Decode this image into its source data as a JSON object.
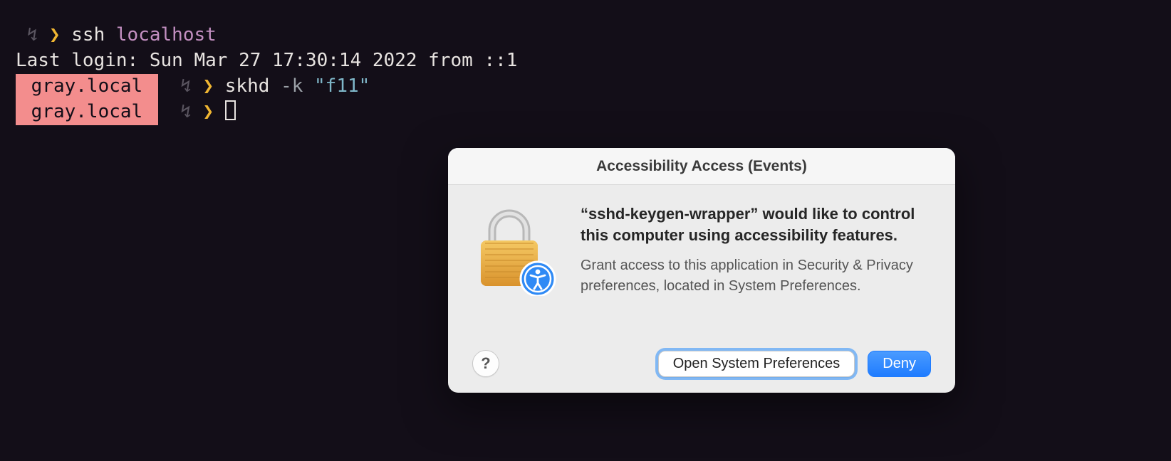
{
  "terminal": {
    "line1": {
      "arrow": "↯",
      "caret": "❯",
      "cmd": "ssh",
      "arg": "localhost"
    },
    "line2": "Last login: Sun Mar 27 17:30:14 2022 from ::1",
    "line3": {
      "host": " gray.local ",
      "arrow": "↯",
      "caret": "❯",
      "cmd": "skhd",
      "flag": "-k",
      "str": "\"f11\""
    },
    "line4": {
      "host": " gray.local ",
      "arrow": "↯",
      "caret": "❯"
    }
  },
  "dialog": {
    "title": "Accessibility Access (Events)",
    "headline": "“sshd-keygen-wrapper” would like to control this computer using accessibility features.",
    "sub": "Grant access to this application in Security & Privacy preferences, located in System Preferences.",
    "help": "?",
    "open_label": "Open System Preferences",
    "deny_label": "Deny"
  }
}
